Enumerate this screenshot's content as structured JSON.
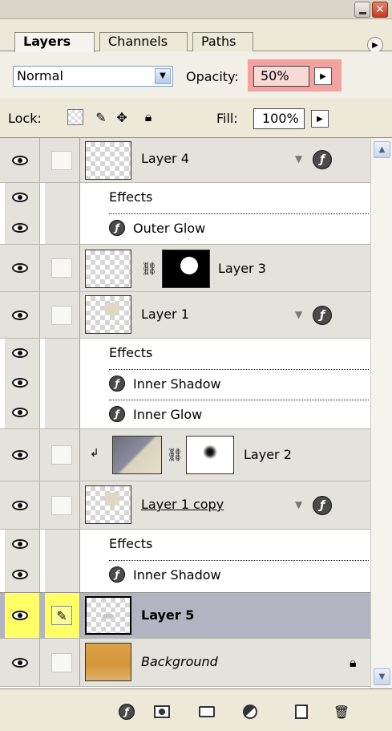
{
  "tabs": [
    {
      "label": "Layers",
      "active": true
    },
    {
      "label": "Channels",
      "active": false
    },
    {
      "label": "Paths",
      "active": false
    }
  ],
  "blend_mode": "Normal",
  "opacity": {
    "label": "Opacity:",
    "value": "50%"
  },
  "lock": {
    "label": "Lock:",
    "icons": [
      "transparency-lock-icon",
      "brush-lock-icon",
      "move-lock-icon",
      "padlock-icon"
    ]
  },
  "fill": {
    "label": "Fill:",
    "value": "100%"
  },
  "layers": {
    "layer4": {
      "name": "Layer 4",
      "effects_label": "Effects",
      "effects": [
        "Outer Glow"
      ]
    },
    "layer3": {
      "name": "Layer 3"
    },
    "layer1": {
      "name": "Layer 1",
      "effects_label": "Effects",
      "effects": [
        "Inner Shadow",
        "Inner Glow"
      ]
    },
    "layer2": {
      "name": "Layer 2"
    },
    "layer1copy": {
      "name": "Layer 1 copy",
      "effects_label": "Effects",
      "effects": [
        "Inner Shadow"
      ]
    },
    "layer5": {
      "name": "Layer 5",
      "selected": true
    },
    "background": {
      "name": "Background",
      "locked": true
    }
  },
  "fx_glyph": "ƒ",
  "colors": {
    "selected_row": "#b3b3c2",
    "opacity_highlight": "#f3a2a0",
    "active_layer_icons": "#ffff66",
    "background_thumb": "#d99b3a"
  },
  "bottom_toolbar": [
    "layer-style-icon",
    "mask-icon",
    "folder-icon",
    "adjustment-layer-icon",
    "new-layer-icon",
    "trash-icon"
  ]
}
